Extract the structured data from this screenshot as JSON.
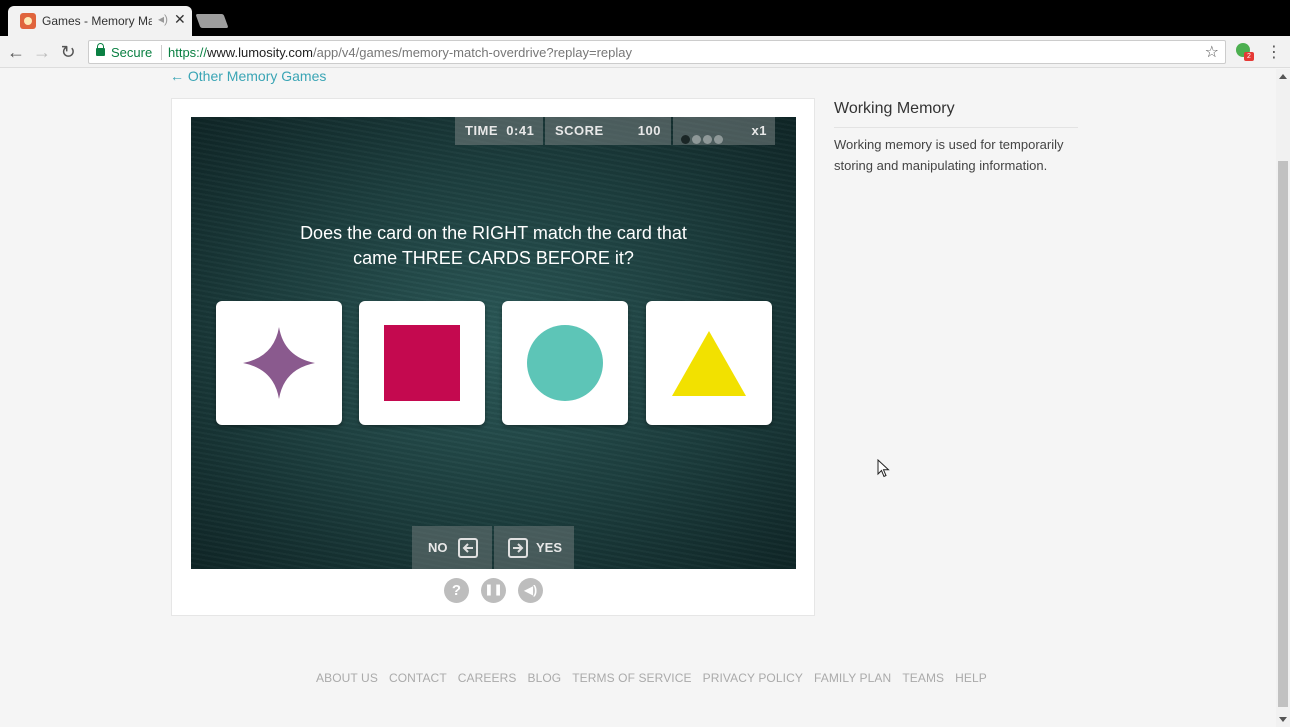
{
  "browser": {
    "tab_title": "Games - Memory Mat",
    "tab_audio_icon": "mute-icon",
    "tab_close": "✕",
    "secure_label": "Secure",
    "url_scheme": "https://",
    "url_host": "www.lumosity.com",
    "url_path": "/app/v4/games/memory-match-overdrive?replay=replay",
    "extension_badge": "2"
  },
  "page": {
    "back_link": "← Other Memory Games"
  },
  "game": {
    "hud": {
      "time_label": "TIME",
      "time_value": "0:41",
      "score_label": "SCORE",
      "score_value": "100",
      "streak_filled": 1,
      "streak_total": 4,
      "multiplier": "x1"
    },
    "question_line1": "Does the card on the RIGHT match the card that",
    "question_line2": "came THREE CARDS BEFORE it?",
    "cards": [
      {
        "shape": "star",
        "color": "#8a5a8e"
      },
      {
        "shape": "square",
        "color": "#c4094f"
      },
      {
        "shape": "circle",
        "color": "#5dc5b7"
      },
      {
        "shape": "triangle",
        "color": "#f2e100"
      }
    ],
    "no_label": "NO",
    "yes_label": "YES",
    "controls": [
      "help-icon",
      "pause-icon",
      "sound-icon"
    ]
  },
  "sidebar": {
    "title": "Working Memory",
    "description": "Working memory is used for temporarily storing and manipulating information."
  },
  "footer": {
    "links": [
      "ABOUT US",
      "CONTACT",
      "CAREERS",
      "BLOG",
      "TERMS OF SERVICE",
      "PRIVACY POLICY",
      "FAMILY PLAN",
      "TEAMS",
      "HELP"
    ]
  },
  "colors": {
    "accent": "#3aa5b5",
    "secure": "#0b8043",
    "stage": "#1c3d3d"
  }
}
